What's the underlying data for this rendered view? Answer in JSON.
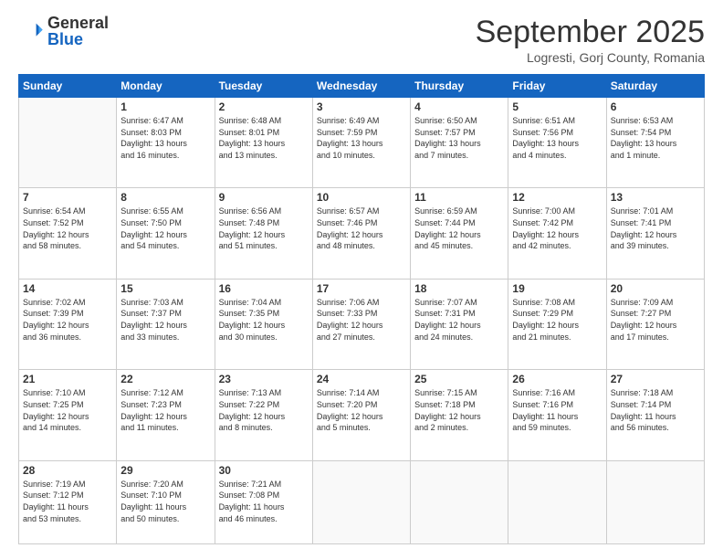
{
  "logo": {
    "general": "General",
    "blue": "Blue"
  },
  "header": {
    "month": "September 2025",
    "location": "Logresti, Gorj County, Romania"
  },
  "weekdays": [
    "Sunday",
    "Monday",
    "Tuesday",
    "Wednesday",
    "Thursday",
    "Friday",
    "Saturday"
  ],
  "weeks": [
    [
      {
        "day": "",
        "info": ""
      },
      {
        "day": "1",
        "info": "Sunrise: 6:47 AM\nSunset: 8:03 PM\nDaylight: 13 hours\nand 16 minutes."
      },
      {
        "day": "2",
        "info": "Sunrise: 6:48 AM\nSunset: 8:01 PM\nDaylight: 13 hours\nand 13 minutes."
      },
      {
        "day": "3",
        "info": "Sunrise: 6:49 AM\nSunset: 7:59 PM\nDaylight: 13 hours\nand 10 minutes."
      },
      {
        "day": "4",
        "info": "Sunrise: 6:50 AM\nSunset: 7:57 PM\nDaylight: 13 hours\nand 7 minutes."
      },
      {
        "day": "5",
        "info": "Sunrise: 6:51 AM\nSunset: 7:56 PM\nDaylight: 13 hours\nand 4 minutes."
      },
      {
        "day": "6",
        "info": "Sunrise: 6:53 AM\nSunset: 7:54 PM\nDaylight: 13 hours\nand 1 minute."
      }
    ],
    [
      {
        "day": "7",
        "info": "Sunrise: 6:54 AM\nSunset: 7:52 PM\nDaylight: 12 hours\nand 58 minutes."
      },
      {
        "day": "8",
        "info": "Sunrise: 6:55 AM\nSunset: 7:50 PM\nDaylight: 12 hours\nand 54 minutes."
      },
      {
        "day": "9",
        "info": "Sunrise: 6:56 AM\nSunset: 7:48 PM\nDaylight: 12 hours\nand 51 minutes."
      },
      {
        "day": "10",
        "info": "Sunrise: 6:57 AM\nSunset: 7:46 PM\nDaylight: 12 hours\nand 48 minutes."
      },
      {
        "day": "11",
        "info": "Sunrise: 6:59 AM\nSunset: 7:44 PM\nDaylight: 12 hours\nand 45 minutes."
      },
      {
        "day": "12",
        "info": "Sunrise: 7:00 AM\nSunset: 7:42 PM\nDaylight: 12 hours\nand 42 minutes."
      },
      {
        "day": "13",
        "info": "Sunrise: 7:01 AM\nSunset: 7:41 PM\nDaylight: 12 hours\nand 39 minutes."
      }
    ],
    [
      {
        "day": "14",
        "info": "Sunrise: 7:02 AM\nSunset: 7:39 PM\nDaylight: 12 hours\nand 36 minutes."
      },
      {
        "day": "15",
        "info": "Sunrise: 7:03 AM\nSunset: 7:37 PM\nDaylight: 12 hours\nand 33 minutes."
      },
      {
        "day": "16",
        "info": "Sunrise: 7:04 AM\nSunset: 7:35 PM\nDaylight: 12 hours\nand 30 minutes."
      },
      {
        "day": "17",
        "info": "Sunrise: 7:06 AM\nSunset: 7:33 PM\nDaylight: 12 hours\nand 27 minutes."
      },
      {
        "day": "18",
        "info": "Sunrise: 7:07 AM\nSunset: 7:31 PM\nDaylight: 12 hours\nand 24 minutes."
      },
      {
        "day": "19",
        "info": "Sunrise: 7:08 AM\nSunset: 7:29 PM\nDaylight: 12 hours\nand 21 minutes."
      },
      {
        "day": "20",
        "info": "Sunrise: 7:09 AM\nSunset: 7:27 PM\nDaylight: 12 hours\nand 17 minutes."
      }
    ],
    [
      {
        "day": "21",
        "info": "Sunrise: 7:10 AM\nSunset: 7:25 PM\nDaylight: 12 hours\nand 14 minutes."
      },
      {
        "day": "22",
        "info": "Sunrise: 7:12 AM\nSunset: 7:23 PM\nDaylight: 12 hours\nand 11 minutes."
      },
      {
        "day": "23",
        "info": "Sunrise: 7:13 AM\nSunset: 7:22 PM\nDaylight: 12 hours\nand 8 minutes."
      },
      {
        "day": "24",
        "info": "Sunrise: 7:14 AM\nSunset: 7:20 PM\nDaylight: 12 hours\nand 5 minutes."
      },
      {
        "day": "25",
        "info": "Sunrise: 7:15 AM\nSunset: 7:18 PM\nDaylight: 12 hours\nand 2 minutes."
      },
      {
        "day": "26",
        "info": "Sunrise: 7:16 AM\nSunset: 7:16 PM\nDaylight: 11 hours\nand 59 minutes."
      },
      {
        "day": "27",
        "info": "Sunrise: 7:18 AM\nSunset: 7:14 PM\nDaylight: 11 hours\nand 56 minutes."
      }
    ],
    [
      {
        "day": "28",
        "info": "Sunrise: 7:19 AM\nSunset: 7:12 PM\nDaylight: 11 hours\nand 53 minutes."
      },
      {
        "day": "29",
        "info": "Sunrise: 7:20 AM\nSunset: 7:10 PM\nDaylight: 11 hours\nand 50 minutes."
      },
      {
        "day": "30",
        "info": "Sunrise: 7:21 AM\nSunset: 7:08 PM\nDaylight: 11 hours\nand 46 minutes."
      },
      {
        "day": "",
        "info": ""
      },
      {
        "day": "",
        "info": ""
      },
      {
        "day": "",
        "info": ""
      },
      {
        "day": "",
        "info": ""
      }
    ]
  ]
}
